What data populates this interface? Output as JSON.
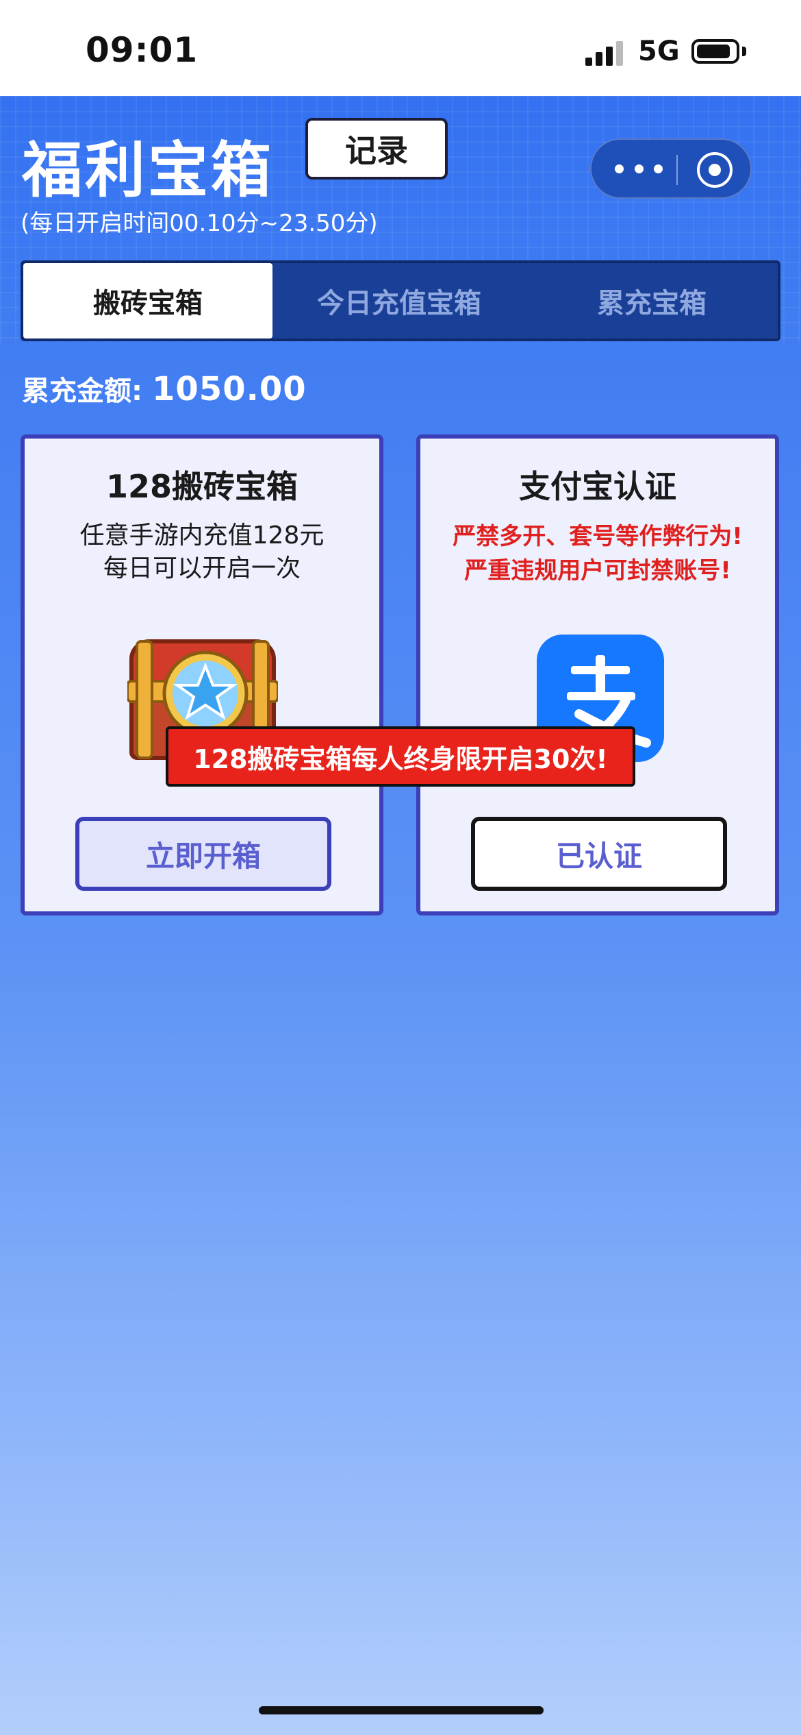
{
  "status_bar": {
    "time": "09:01",
    "network": "5G"
  },
  "header": {
    "title": "福利宝箱",
    "record_button": "记录",
    "subtitle": "(每日开启时间00.10分~23.50分)"
  },
  "tabs": [
    {
      "label": "搬砖宝箱",
      "active": true
    },
    {
      "label": "今日充值宝箱",
      "active": false
    },
    {
      "label": "累充宝箱",
      "active": false
    }
  ],
  "total_recharge": {
    "label": "累充金额:",
    "value": "1050.00"
  },
  "cards": {
    "chest": {
      "title": "128搬砖宝箱",
      "desc_line1": "任意手游内充值128元",
      "desc_line2": "每日可以开启一次",
      "button": "立即开箱",
      "icon": "treasure-chest-icon"
    },
    "alipay": {
      "title": "支付宝认证",
      "warn_line1": "严禁多开、套号等作弊行为!",
      "warn_line2": "严重违规用户可封禁账号!",
      "button": "已认证",
      "icon": "alipay-icon"
    }
  },
  "banner": "128搬砖宝箱每人终身限开启30次!",
  "colors": {
    "accent": "#3b3fb8",
    "warning": "#e0201e",
    "alipay": "#1677ff"
  }
}
